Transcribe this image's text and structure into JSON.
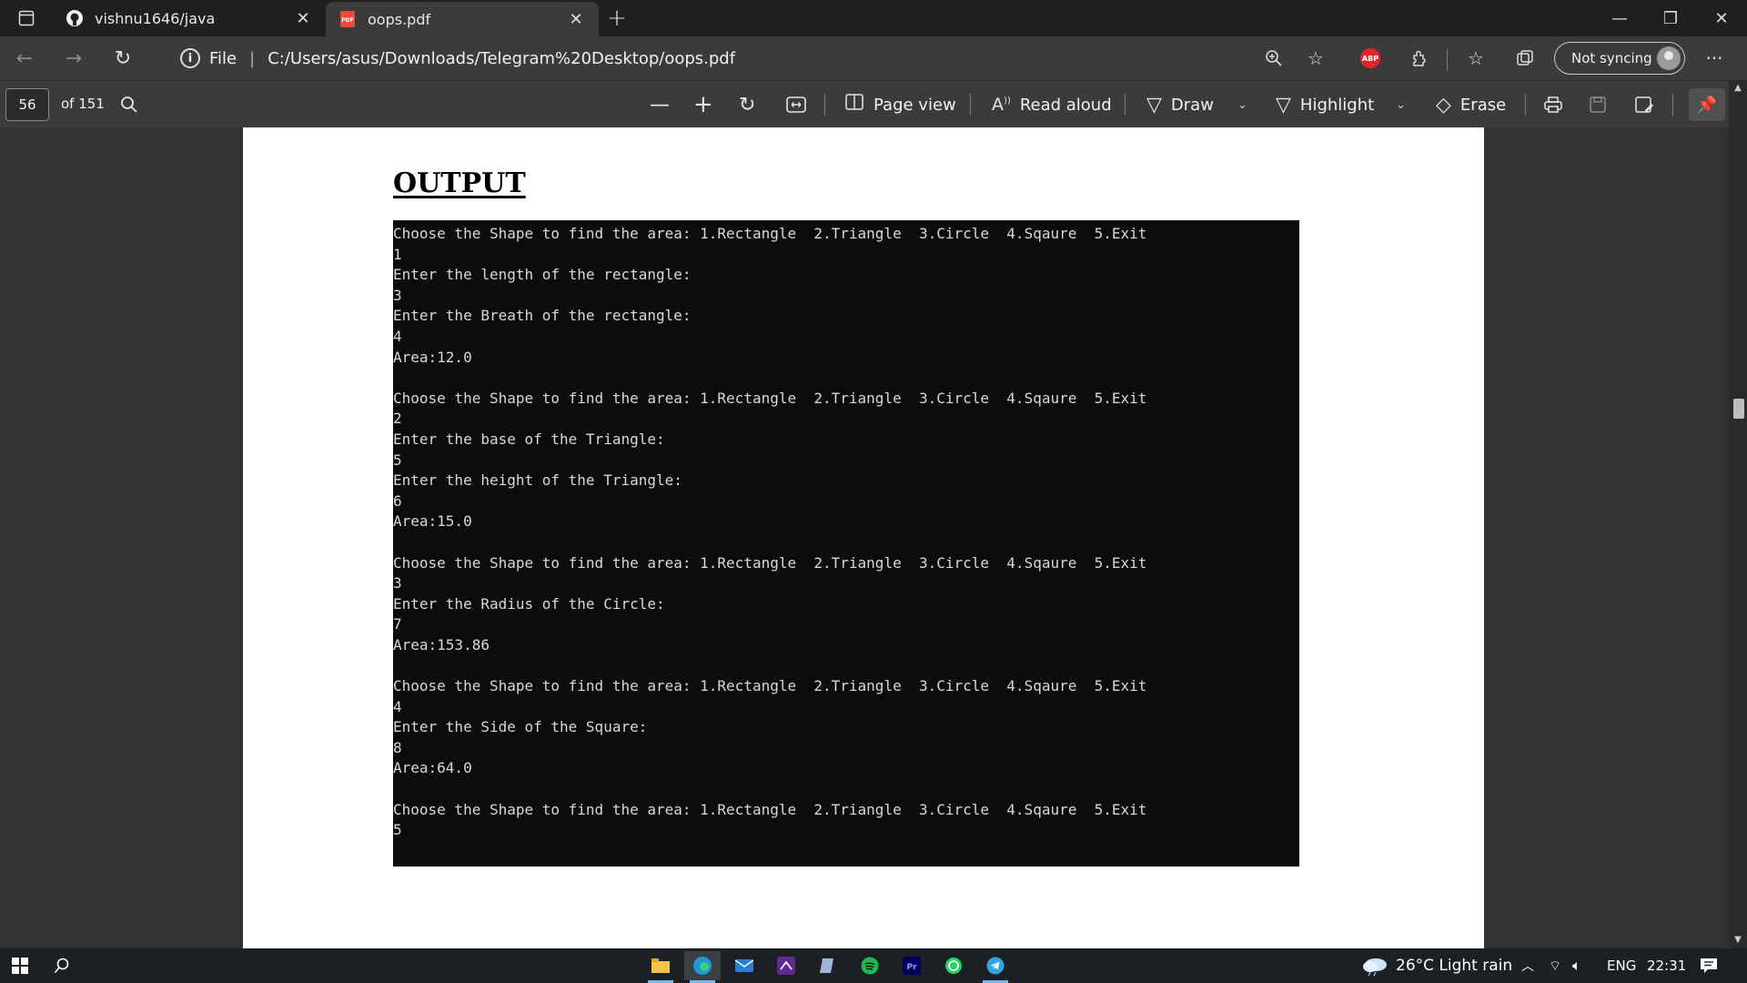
{
  "browser": {
    "tabs": [
      {
        "title": "vishnu1646/java",
        "icon": "github-icon"
      },
      {
        "title": "oops.pdf",
        "icon": "pdf-icon"
      }
    ],
    "address": {
      "scheme_label": "File",
      "url": "C:/Users/asus/Downloads/Telegram%20Desktop/oops.pdf"
    },
    "sync_label": "Not syncing"
  },
  "pdf_toolbar": {
    "page_number": "56",
    "page_count": "of 151",
    "page_view_label": "Page view",
    "read_aloud_label": "Read aloud",
    "draw_label": "Draw",
    "highlight_label": "Highlight",
    "erase_label": "Erase"
  },
  "document": {
    "heading": "OUTPUT",
    "console_lines": [
      "Choose the Shape to find the area: 1.Rectangle  2.Triangle  3.Circle  4.Sqaure  5.Exit",
      "1",
      "Enter the length of the rectangle:",
      "3",
      "Enter the Breath of the rectangle:",
      "4",
      "Area:12.0",
      "",
      "Choose the Shape to find the area: 1.Rectangle  2.Triangle  3.Circle  4.Sqaure  5.Exit",
      "2",
      "Enter the base of the Triangle:",
      "5",
      "Enter the height of the Triangle:",
      "6",
      "Area:15.0",
      "",
      "Choose the Shape to find the area: 1.Rectangle  2.Triangle  3.Circle  4.Sqaure  5.Exit",
      "3",
      "Enter the Radius of the Circle:",
      "7",
      "Area:153.86",
      "",
      "Choose the Shape to find the area: 1.Rectangle  2.Triangle  3.Circle  4.Sqaure  5.Exit",
      "4",
      "Enter the Side of the Square:",
      "8",
      "Area:64.0",
      "",
      "Choose the Shape to find the area: 1.Rectangle  2.Triangle  3.Circle  4.Sqaure  5.Exit",
      "5"
    ]
  },
  "taskbar": {
    "weather": "26°C  Light rain",
    "language": "ENG",
    "time": "22:31"
  }
}
